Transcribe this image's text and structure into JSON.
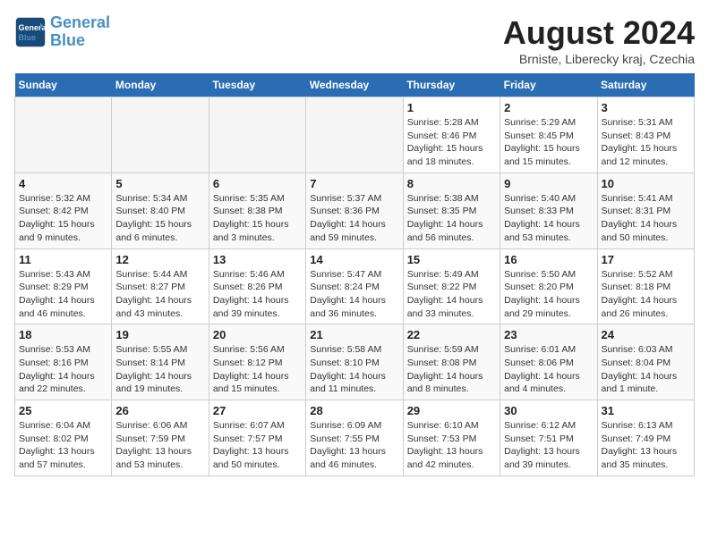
{
  "header": {
    "logo_line1": "General",
    "logo_line2": "Blue",
    "month_title": "August 2024",
    "subtitle": "Brniste, Liberecky kraj, Czechia"
  },
  "weekdays": [
    "Sunday",
    "Monday",
    "Tuesday",
    "Wednesday",
    "Thursday",
    "Friday",
    "Saturday"
  ],
  "weeks": [
    [
      {
        "day": "",
        "info": ""
      },
      {
        "day": "",
        "info": ""
      },
      {
        "day": "",
        "info": ""
      },
      {
        "day": "",
        "info": ""
      },
      {
        "day": "1",
        "info": "Sunrise: 5:28 AM\nSunset: 8:46 PM\nDaylight: 15 hours\nand 18 minutes."
      },
      {
        "day": "2",
        "info": "Sunrise: 5:29 AM\nSunset: 8:45 PM\nDaylight: 15 hours\nand 15 minutes."
      },
      {
        "day": "3",
        "info": "Sunrise: 5:31 AM\nSunset: 8:43 PM\nDaylight: 15 hours\nand 12 minutes."
      }
    ],
    [
      {
        "day": "4",
        "info": "Sunrise: 5:32 AM\nSunset: 8:42 PM\nDaylight: 15 hours\nand 9 minutes."
      },
      {
        "day": "5",
        "info": "Sunrise: 5:34 AM\nSunset: 8:40 PM\nDaylight: 15 hours\nand 6 minutes."
      },
      {
        "day": "6",
        "info": "Sunrise: 5:35 AM\nSunset: 8:38 PM\nDaylight: 15 hours\nand 3 minutes."
      },
      {
        "day": "7",
        "info": "Sunrise: 5:37 AM\nSunset: 8:36 PM\nDaylight: 14 hours\nand 59 minutes."
      },
      {
        "day": "8",
        "info": "Sunrise: 5:38 AM\nSunset: 8:35 PM\nDaylight: 14 hours\nand 56 minutes."
      },
      {
        "day": "9",
        "info": "Sunrise: 5:40 AM\nSunset: 8:33 PM\nDaylight: 14 hours\nand 53 minutes."
      },
      {
        "day": "10",
        "info": "Sunrise: 5:41 AM\nSunset: 8:31 PM\nDaylight: 14 hours\nand 50 minutes."
      }
    ],
    [
      {
        "day": "11",
        "info": "Sunrise: 5:43 AM\nSunset: 8:29 PM\nDaylight: 14 hours\nand 46 minutes."
      },
      {
        "day": "12",
        "info": "Sunrise: 5:44 AM\nSunset: 8:27 PM\nDaylight: 14 hours\nand 43 minutes."
      },
      {
        "day": "13",
        "info": "Sunrise: 5:46 AM\nSunset: 8:26 PM\nDaylight: 14 hours\nand 39 minutes."
      },
      {
        "day": "14",
        "info": "Sunrise: 5:47 AM\nSunset: 8:24 PM\nDaylight: 14 hours\nand 36 minutes."
      },
      {
        "day": "15",
        "info": "Sunrise: 5:49 AM\nSunset: 8:22 PM\nDaylight: 14 hours\nand 33 minutes."
      },
      {
        "day": "16",
        "info": "Sunrise: 5:50 AM\nSunset: 8:20 PM\nDaylight: 14 hours\nand 29 minutes."
      },
      {
        "day": "17",
        "info": "Sunrise: 5:52 AM\nSunset: 8:18 PM\nDaylight: 14 hours\nand 26 minutes."
      }
    ],
    [
      {
        "day": "18",
        "info": "Sunrise: 5:53 AM\nSunset: 8:16 PM\nDaylight: 14 hours\nand 22 minutes."
      },
      {
        "day": "19",
        "info": "Sunrise: 5:55 AM\nSunset: 8:14 PM\nDaylight: 14 hours\nand 19 minutes."
      },
      {
        "day": "20",
        "info": "Sunrise: 5:56 AM\nSunset: 8:12 PM\nDaylight: 14 hours\nand 15 minutes."
      },
      {
        "day": "21",
        "info": "Sunrise: 5:58 AM\nSunset: 8:10 PM\nDaylight: 14 hours\nand 11 minutes."
      },
      {
        "day": "22",
        "info": "Sunrise: 5:59 AM\nSunset: 8:08 PM\nDaylight: 14 hours\nand 8 minutes."
      },
      {
        "day": "23",
        "info": "Sunrise: 6:01 AM\nSunset: 8:06 PM\nDaylight: 14 hours\nand 4 minutes."
      },
      {
        "day": "24",
        "info": "Sunrise: 6:03 AM\nSunset: 8:04 PM\nDaylight: 14 hours\nand 1 minute."
      }
    ],
    [
      {
        "day": "25",
        "info": "Sunrise: 6:04 AM\nSunset: 8:02 PM\nDaylight: 13 hours\nand 57 minutes."
      },
      {
        "day": "26",
        "info": "Sunrise: 6:06 AM\nSunset: 7:59 PM\nDaylight: 13 hours\nand 53 minutes."
      },
      {
        "day": "27",
        "info": "Sunrise: 6:07 AM\nSunset: 7:57 PM\nDaylight: 13 hours\nand 50 minutes."
      },
      {
        "day": "28",
        "info": "Sunrise: 6:09 AM\nSunset: 7:55 PM\nDaylight: 13 hours\nand 46 minutes."
      },
      {
        "day": "29",
        "info": "Sunrise: 6:10 AM\nSunset: 7:53 PM\nDaylight: 13 hours\nand 42 minutes."
      },
      {
        "day": "30",
        "info": "Sunrise: 6:12 AM\nSunset: 7:51 PM\nDaylight: 13 hours\nand 39 minutes."
      },
      {
        "day": "31",
        "info": "Sunrise: 6:13 AM\nSunset: 7:49 PM\nDaylight: 13 hours\nand 35 minutes."
      }
    ]
  ]
}
